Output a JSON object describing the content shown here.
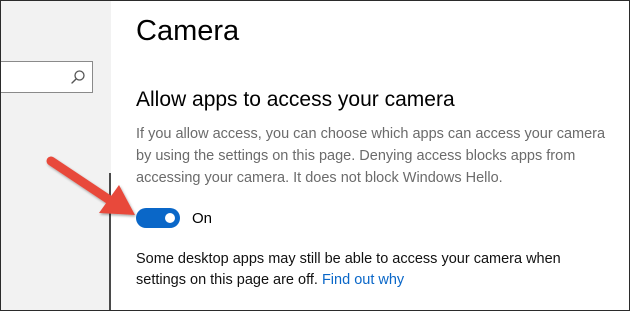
{
  "header": {
    "title": "Camera"
  },
  "sidebar": {
    "search": {
      "value": "",
      "placeholder": ""
    },
    "search_icon": "search-icon"
  },
  "section": {
    "title": "Allow apps to access your camera",
    "description_lines": [
      "If you allow access, you can choose which apps can access your camera",
      "by using the settings on this page. Denying access blocks apps from",
      "accessing your camera. It does not block Windows Hello."
    ]
  },
  "toggle": {
    "state": "on",
    "label": "On",
    "color": "#0a67c8"
  },
  "note": {
    "line1": "Some desktop apps may still be able to access your camera when",
    "line2": "settings on this page are off.",
    "link_text": "Find out why"
  },
  "annotation": {
    "arrow_color": "#e8483a"
  }
}
